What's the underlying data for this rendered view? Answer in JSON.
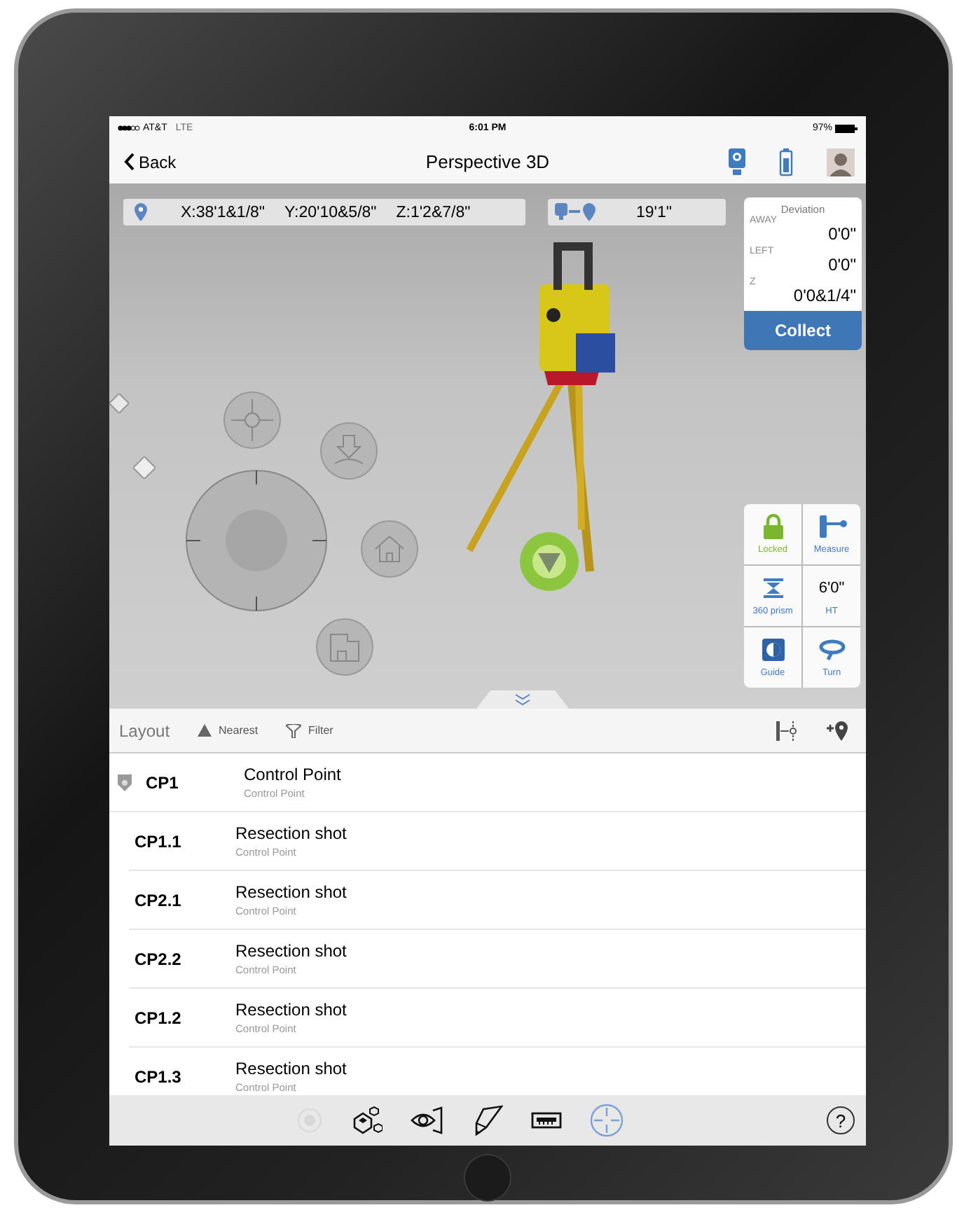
{
  "status_bar": {
    "carrier": "AT&T",
    "network": "LTE",
    "time": "6:01 PM",
    "battery": "97%"
  },
  "nav": {
    "back": "Back",
    "title": "Perspective 3D"
  },
  "coordinates": {
    "x": "X:38'1&1/8\"",
    "y": "Y:20'10&5/8\"",
    "z": "Z:1'2&7/8\""
  },
  "distance": "19'1\"",
  "deviation": {
    "title": "Deviation",
    "rows": [
      {
        "label": "AWAY",
        "value": "0'0\""
      },
      {
        "label": "LEFT",
        "value": "0'0\""
      },
      {
        "label": "Z",
        "value": "0'0&1/4\""
      }
    ],
    "collect": "Collect"
  },
  "control_rows": [
    {
      "items": [
        {
          "kind": "lock",
          "label": "Locked"
        },
        {
          "kind": "measure",
          "label": "Measure"
        }
      ]
    },
    {
      "items": [
        {
          "kind": "prism",
          "label": "360 prism"
        },
        {
          "kind": "value",
          "label": "HT",
          "value": "6'0\""
        }
      ]
    },
    {
      "items": [
        {
          "kind": "guide",
          "label": "Guide"
        },
        {
          "kind": "turn",
          "label": "Turn"
        }
      ]
    }
  ],
  "list_header": {
    "title": "Layout",
    "sort": "Nearest",
    "filter": "Filter"
  },
  "rows": [
    {
      "kind": "control",
      "id": "CP1",
      "name": "Control Point",
      "type": "Control Point"
    },
    {
      "kind": "shot",
      "id": "CP1.1",
      "name": "Resection shot",
      "type": "Control Point"
    },
    {
      "kind": "shot",
      "id": "CP2.1",
      "name": "Resection shot",
      "type": "Control Point"
    },
    {
      "kind": "shot",
      "id": "CP2.2",
      "name": "Resection shot",
      "type": "Control Point"
    },
    {
      "kind": "shot",
      "id": "CP1.2",
      "name": "Resection shot",
      "type": "Control Point"
    },
    {
      "kind": "shot",
      "id": "CP1.3",
      "name": "Resection shot",
      "type": "Control Point"
    }
  ],
  "toolbar": [
    {
      "kind": "target",
      "selected": false,
      "disabled": true
    },
    {
      "kind": "cubes",
      "selected": false,
      "disabled": false
    },
    {
      "kind": "eye",
      "selected": false,
      "disabled": false
    },
    {
      "kind": "pen",
      "selected": false,
      "disabled": false
    },
    {
      "kind": "ruler",
      "selected": false,
      "disabled": false
    },
    {
      "kind": "crosshair",
      "selected": true,
      "disabled": false
    }
  ],
  "help": "?"
}
